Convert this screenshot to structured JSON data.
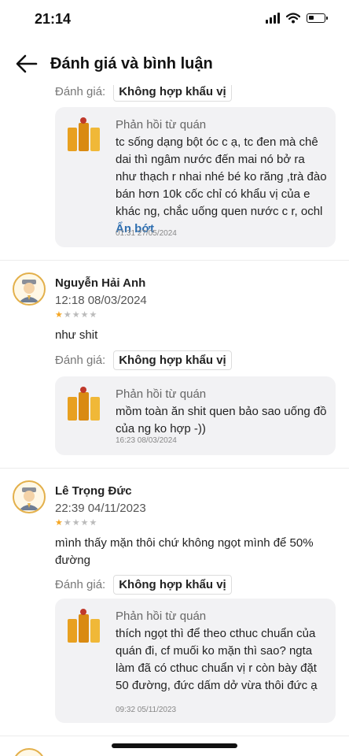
{
  "status_bar": {
    "time": "21:14",
    "battery_level": 0.25
  },
  "header": {
    "title": "Đánh giá và bình luận"
  },
  "rating_label": "Đánh giá:",
  "reply_title": "Phản hồi từ quán",
  "top_review": {
    "tag": "Không hợp khẩu vị",
    "reply_text": "tc sống dạng bột óc c ạ, tc đen mà chê dai thì ngâm nước đến mai nó bở ra như thạch r nhai nhé bé ko răng ,trà đào bán hơn 10k cốc chỉ có khẩu vị của e khác ng, chắc uống quen nước c r, ochl",
    "collapse_label": "Ẩn bớt",
    "reply_date": "01:31 27/05/2024"
  },
  "reviews": [
    {
      "name": "Nguyễn Hải Anh",
      "time": "12:18 08/03/2024",
      "stars": 1,
      "text": "như shit",
      "tag": "Không hợp khẩu vị",
      "reply_text": "mồm toàn ăn shit quen bảo sao uống đồ của ng  ko hợp -))",
      "reply_date": "16:23 08/03/2024"
    },
    {
      "name": "Lê Trọng Đức",
      "time": "22:39 04/11/2023",
      "stars": 1,
      "text": "mình thấy mặn thôi chứ không ngọt mình để 50% đường",
      "tag": "Không hợp khẩu vị",
      "reply_text": "thích ngọt thì để theo cthuc chuẩn của quán đi, cf muối ko mặn thì sao? ngta làm đã có cthuc chuẩn vị r còn bày đặt 50 đường, đức dấm dở vừa thôi đức ạ",
      "reply_date": "09:32 05/11/2023"
    }
  ]
}
